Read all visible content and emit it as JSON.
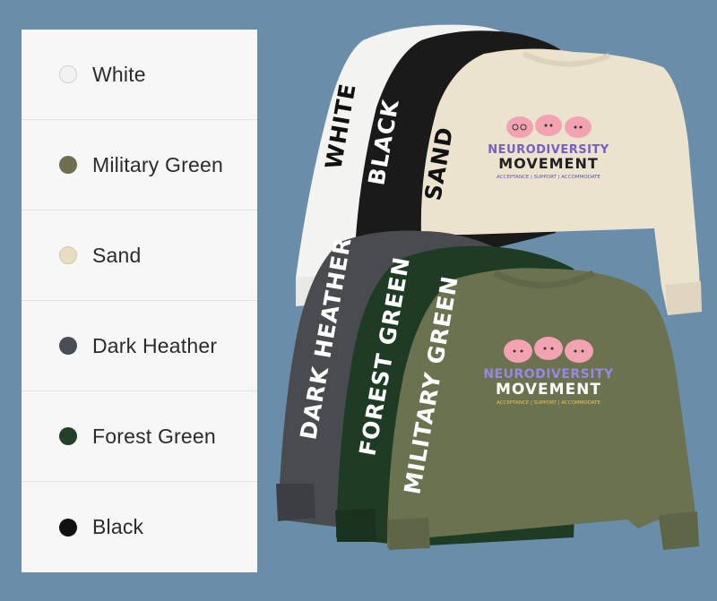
{
  "color_options": [
    {
      "label": "White",
      "color": "#f2f2f2"
    },
    {
      "label": "Military Green",
      "color": "#6c6e4e"
    },
    {
      "label": "Sand",
      "color": "#e8dcc1"
    },
    {
      "label": "Dark Heather",
      "color": "#4b4d56"
    },
    {
      "label": "Forest Green",
      "color": "#23402a"
    },
    {
      "label": "Black",
      "color": "#111111"
    }
  ],
  "product_image": {
    "sleeve_labels": {
      "white": "WHITE",
      "black": "BLACK",
      "sand": "SAND",
      "dark_heather": "DARK HEATHER",
      "forest_green": "FOREST GREEN",
      "military_green": "MILITARY GREEN"
    },
    "graphic": {
      "title_line1": "NEURODIVERSITY",
      "title_line2": "MOVEMENT",
      "tagline": "ACCEPTANCE | SUPPORT | ACCOMMODATE"
    },
    "colors": {
      "background": "#6a8ea9",
      "white": "#f3f3f1",
      "black": "#1a1a1a",
      "sand": "#ece3cf",
      "dark_heather": "#4a4b4f",
      "forest_green": "#1e3b24",
      "military_green": "#6b7250",
      "brain_pink": "#f2a2b0"
    }
  }
}
